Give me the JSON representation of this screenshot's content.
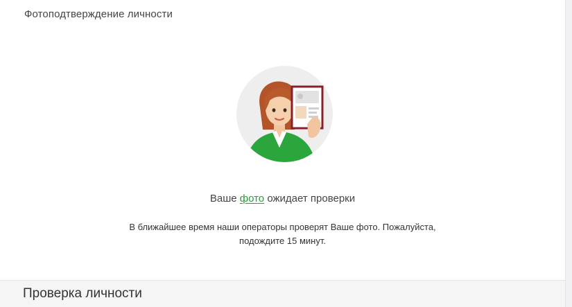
{
  "section": {
    "title": "Фотоподтверждение личности"
  },
  "status": {
    "prefix": "Ваше ",
    "link": "фото",
    "suffix": " ожидает проверки"
  },
  "note": {
    "line1": "В ближайшее время наши операторы проверят Ваше фото. Пожалуйста,",
    "line2": "подождите 15 минут."
  },
  "footer": {
    "title": "Проверка личности"
  },
  "colors": {
    "accent": "#21a038",
    "badge_circle": "#eeeeee"
  },
  "icons": {
    "illustration": "woman-holding-id-document"
  }
}
